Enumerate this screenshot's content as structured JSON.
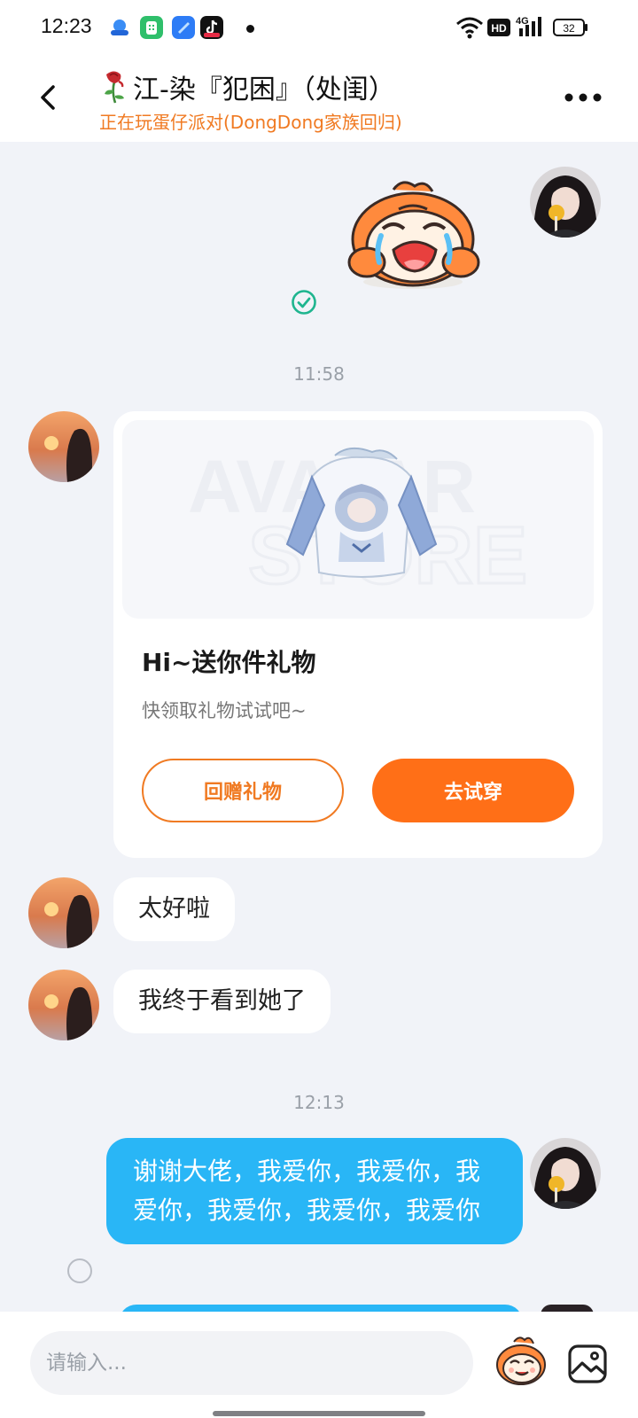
{
  "status_bar": {
    "time": "12:23",
    "network": "4G",
    "hd": "HD",
    "battery": "32",
    "icons": [
      "baidu-netdisk-icon",
      "green-app-icon",
      "blue-app-icon",
      "tiktok-icon",
      "notification-dot-icon",
      "wifi-icon",
      "hd-icon",
      "signal-icon",
      "battery-icon"
    ]
  },
  "header": {
    "title": "江-染『犯困』（处闺）",
    "subtitle": "正在玩蛋仔派对(DongDong家族回归)",
    "back_icon": "chevron-left-icon",
    "more_icon": "more-dots-icon",
    "title_icon": "wilted-rose-icon"
  },
  "messages": {
    "time_1": "11:58",
    "time_2": "12:13",
    "gift_card": {
      "watermark_line1": "AVATAR",
      "watermark_line2": "STORE",
      "title": "Hi~送你件礼物",
      "subtitle": "快领取礼物试试吧~",
      "return_gift_label": "回赠礼物",
      "try_on_label": "去试穿"
    },
    "incoming_1": "太好啦",
    "incoming_2": "我终于看到她了",
    "outgoing_1": "谢谢大佬，我爱你，我爱你，我爱你，我爱你，我爱你，我爱你"
  },
  "input": {
    "placeholder": "请输入..."
  },
  "colors": {
    "accent_orange": "#ff6f17",
    "subtitle_orange": "#f07a22",
    "outgoing_bubble": "#29b6f6",
    "read_check": "#1fb58f",
    "background": "#f1f3f8"
  }
}
